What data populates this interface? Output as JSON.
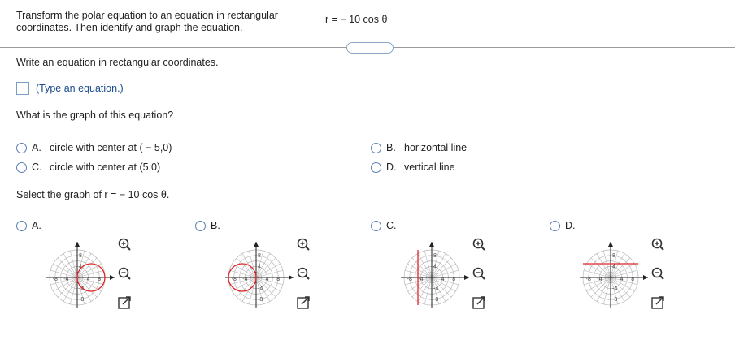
{
  "prompt": {
    "line1": "Transform the polar equation to an equation in rectangular",
    "line2": "coordinates.  Then identify and graph the equation."
  },
  "equation": "r =  − 10 cos θ",
  "more_button": ".....",
  "q1": {
    "text": "Write an equation in rectangular coordinates.",
    "hint": "(Type an equation.)"
  },
  "q2": {
    "text": "What is the graph of this equation?",
    "options": [
      {
        "letter": "A.",
        "text": "circle with center at ( − 5,0)"
      },
      {
        "letter": "B.",
        "text": "horizontal line"
      },
      {
        "letter": "C.",
        "text": "circle with center at (5,0)"
      },
      {
        "letter": "D.",
        "text": "vertical line"
      }
    ]
  },
  "q3": {
    "text": "Select the graph of r =  − 10 cos θ.",
    "options": [
      {
        "letter": "A.",
        "shape": "circle centered at (5,0)"
      },
      {
        "letter": "B.",
        "shape": "circle centered at (-5,0)"
      },
      {
        "letter": "C.",
        "shape": "vertical line x = -5"
      },
      {
        "letter": "D.",
        "shape": "horizontal line y = 5"
      }
    ],
    "tick_labels": {
      "x": [
        "-8",
        "-4",
        "4",
        "8"
      ],
      "y": [
        "8",
        "4",
        "-4",
        "-8"
      ]
    }
  },
  "icons": {
    "zoom_in": "zoom-in-icon",
    "zoom_out": "zoom-out-icon",
    "expand": "expand-icon"
  },
  "colors": {
    "accent": "#1a4c8b",
    "graph": "#e0262b",
    "grid": "#b8b8b8"
  }
}
